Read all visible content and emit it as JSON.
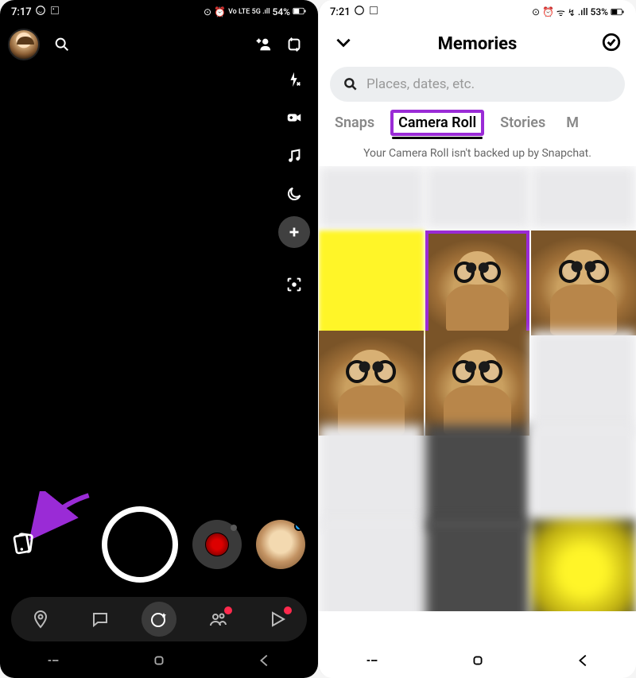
{
  "left": {
    "status": {
      "time": "7:17",
      "battery": "54%",
      "net": "Vo LTE 5G .ıll"
    },
    "addfriend_icon_label": "+",
    "sidebar_icons": [
      "flip",
      "flash",
      "action-cam",
      "music",
      "night",
      "plus",
      "scan"
    ]
  },
  "right": {
    "status": {
      "time": "7:21",
      "battery": "53%",
      "net": ".ıll"
    },
    "title": "Memories",
    "search_placeholder": "Places, dates, etc.",
    "tabs": {
      "snaps": "Snaps",
      "camera_roll": "Camera Roll",
      "stories": "Stories",
      "more": "M"
    },
    "notice": "Your Camera Roll isn't backed up by Snapchat."
  },
  "highlight_color": "#9a2bd6"
}
